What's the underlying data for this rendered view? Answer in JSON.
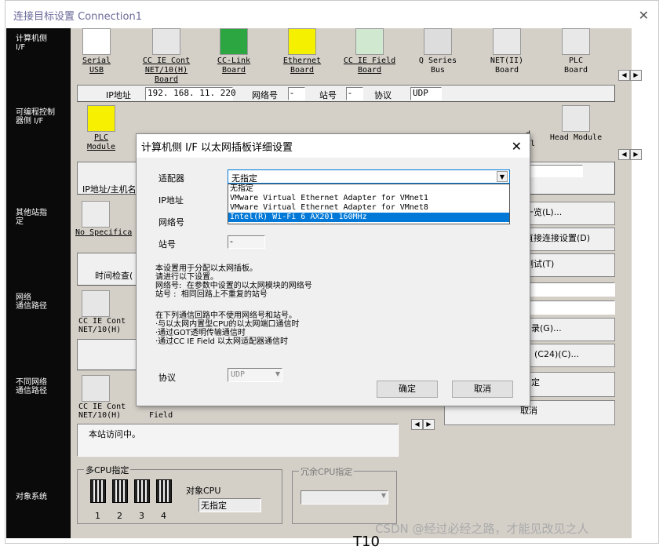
{
  "window": {
    "title": "连接目标设置 Connection1",
    "close_icon": "close-icon"
  },
  "left_labels": {
    "pc_side": "计算机侧\nI/F",
    "plc_side": "可编程控制\n器侧 I/F",
    "other_station": "其他站指\n定",
    "network_route": "网络\n通信路径",
    "diff_network": "不同网络\n通信路径",
    "target_system": "对象系统"
  },
  "pc_cards": [
    {
      "label": "Serial\nUSB",
      "icon": "serial-usb-icon"
    },
    {
      "label": "CC IE Cont\nNET/10(H)\nBoard",
      "icon": "cc-ie-cont-icon"
    },
    {
      "label": "CC-Link\nBoard",
      "icon": "cc-link-icon"
    },
    {
      "label": "Ethernet\nBoard",
      "icon": "ethernet-board-icon"
    },
    {
      "label": "CC IE Field\nBoard",
      "icon": "cc-ie-field-icon"
    },
    {
      "label": "Q Series\nBus",
      "icon": "q-series-bus-icon"
    },
    {
      "label": "NET(II)\nBoard",
      "icon": "net-board-icon"
    },
    {
      "label": "PLC\nBoard",
      "icon": "plc-board-icon"
    }
  ],
  "ip_row": {
    "ip_label": "IP地址",
    "ip_value": "192. 168. 11. 220",
    "net_label": "网络号",
    "net_value": "-",
    "station_label": "站号",
    "station_value": "-",
    "protocol_label": "协议",
    "protocol_value": "UDP"
  },
  "plc_cards": [
    {
      "label": "PLC\nModule",
      "icon": "plc-module-icon"
    },
    {
      "label": "Head Module",
      "icon": "head-module-icon"
    }
  ],
  "plc_partial": {
    "ip_host": "IP地址/主机名",
    "cc_field_partial": "d\nal"
  },
  "other": {
    "no_spec": "No Specifica",
    "time_check": "时间检查("
  },
  "network": {
    "card1": "CC IE Cont\nNET/10(H)",
    "card2": "CC IE Cont\nNET/10(H)",
    "field": "Field"
  },
  "status": {
    "access_text": "本站访问中。"
  },
  "right_buttons": {
    "list": "一览(L)...",
    "direct": "直接连接设置(D)",
    "test": "测试(T)",
    "route_g": "录(G)...",
    "c24": "(C24)(C)...",
    "fix": "定",
    "cancel": "取消"
  },
  "multi_cpu": {
    "legend": "多CPU指定",
    "target_cpu": "对象CPU",
    "unspecified": "无指定",
    "nums": [
      "1",
      "2",
      "3",
      "4"
    ]
  },
  "redundant": {
    "legend": "冗余CPU指定"
  },
  "dialog": {
    "title": "计算机侧 I/F 以太网插板详细设置",
    "adapter_label": "适配器",
    "adapter_value": "无指定",
    "adapter_options": [
      "无指定",
      "VMware Virtual Ethernet Adapter for VMnet1",
      "VMware Virtual Ethernet Adapter for VMnet8",
      "Intel(R) Wi-Fi 6 AX201 160MHz"
    ],
    "ip_label": "IP地址",
    "net_label": "网络号",
    "station_label": "站号",
    "station_value": "-",
    "info1": "本设置用于分配以太网插板。\n请进行以下设置。\n网络号:  在参数中设置的以太网模块的网络号\n站号 :  相同回路上不重复的站号",
    "info2": "在下列通信回路中不使用网络号和站号。\n·与以太网内置型CPU的以太网端口通信时\n·通过GOT透明传输通信时\n·通过CC IE Field 以太网适配器通信时",
    "protocol_label": "协议",
    "protocol_value": "UDP",
    "ok": "确定",
    "cancel": "取消"
  },
  "watermark": "CSDN @经过必经之路，才能见改见之人",
  "bottom_partial": "T10"
}
